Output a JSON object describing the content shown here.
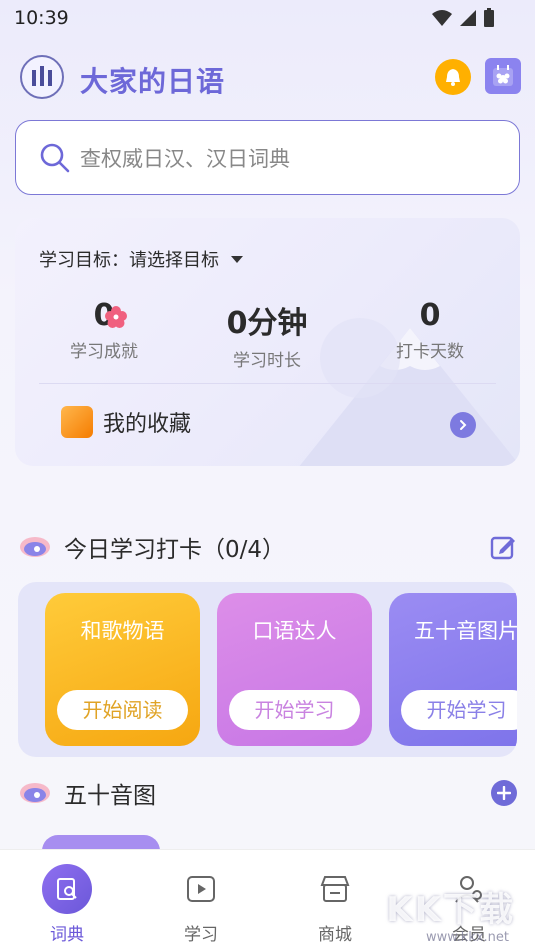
{
  "status_bar": {
    "time": "10:39"
  },
  "header": {
    "title": "大家的日语"
  },
  "search": {
    "placeholder": "查权威日汉、汉日词典"
  },
  "goal_card": {
    "goal_label": "学习目标：请选择目标",
    "stats": [
      {
        "value": "0",
        "label": "学习成就"
      },
      {
        "value": "0分钟",
        "label": "学习时长"
      },
      {
        "value": "0",
        "label": "打卡天数"
      }
    ],
    "favorites_label": "我的收藏"
  },
  "checkin": {
    "title": "今日学习打卡（0/4）",
    "cards": [
      {
        "title": "和歌物语",
        "button": "开始阅读"
      },
      {
        "title": "口语达人",
        "button": "开始学习"
      },
      {
        "title": "五十音图片",
        "button": "开始学习"
      }
    ]
  },
  "gojuon": {
    "title": "五十音图"
  },
  "bottom_nav": {
    "items": [
      {
        "label": "词典",
        "icon": "dictionary-icon",
        "active": true
      },
      {
        "label": "学习",
        "icon": "play-icon",
        "active": false
      },
      {
        "label": "商城",
        "icon": "store-icon",
        "active": false
      },
      {
        "label": "会员",
        "icon": "member-icon",
        "active": false
      }
    ]
  },
  "watermark": {
    "text": "KK下载",
    "url_text": "www.kkx.net"
  },
  "colors": {
    "accent": "#6d68d8",
    "bell": "#ffb000",
    "card_yellow": "#f6a711",
    "card_pink": "#c676e6",
    "card_purple": "#7d73ea"
  }
}
